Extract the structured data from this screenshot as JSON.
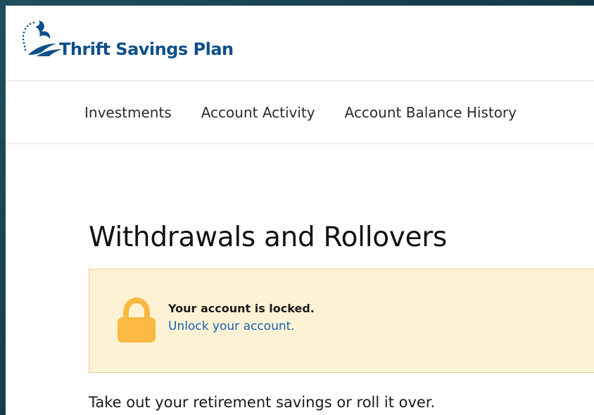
{
  "header": {
    "logo_text": "Thrift Savings Plan"
  },
  "nav": {
    "items": [
      {
        "label": "Investments"
      },
      {
        "label": "Account Activity"
      },
      {
        "label": "Account Balance History"
      }
    ]
  },
  "main": {
    "title": "Withdrawals and Rollovers",
    "alert": {
      "title": "Your account is locked.",
      "link": "Unlock your account.",
      "icon": "lock-icon"
    },
    "intro": "Take out your retirement savings or roll it over."
  },
  "colors": {
    "brand": "#0d4f8a",
    "link": "#1a5fb4",
    "alert_bg": "#fdf3d4",
    "alert_border": "#f0c98b",
    "lock": "#fbb843"
  }
}
